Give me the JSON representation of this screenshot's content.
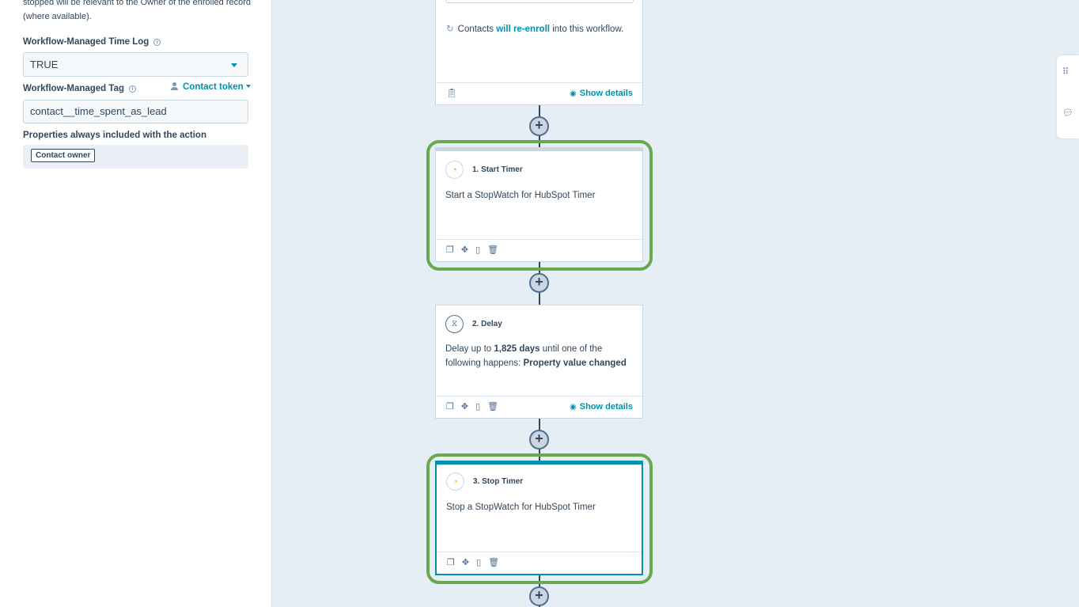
{
  "left_panel": {
    "intro_text": "stopped will be relevant to the Owner of the enrolled record (where available).",
    "time_log": {
      "label": "Workflow-Managed Time Log",
      "value": "TRUE"
    },
    "tag": {
      "label": "Workflow-Managed Tag",
      "token_link": "Contact token",
      "value": "contact__time_spent_as_lead"
    },
    "properties": {
      "label": "Properties always included with the action",
      "chip": "Contact owner"
    }
  },
  "canvas": {
    "trigger_card": {
      "re_enroll_prefix": "Contacts",
      "re_enroll_link": "will re-enroll",
      "re_enroll_suffix": "into this workflow.",
      "show_details": "Show details"
    },
    "step1": {
      "title": "1. Start Timer",
      "body": "Start a StopWatch for HubSpot Timer"
    },
    "step2": {
      "title": "2. Delay",
      "body_prefix": "Delay up to",
      "body_days": "1,825 days",
      "body_middle": "until one of the following happens:",
      "body_condition": "Property value changed",
      "show_details": "Show details"
    },
    "step3": {
      "title": "3. Stop Timer",
      "body": "Stop a StopWatch for HubSpot Timer"
    },
    "plus": "+"
  },
  "colors": {
    "accent": "#0091ae",
    "highlight": "#6aa84f",
    "canvas_bg": "#e5edf5"
  }
}
